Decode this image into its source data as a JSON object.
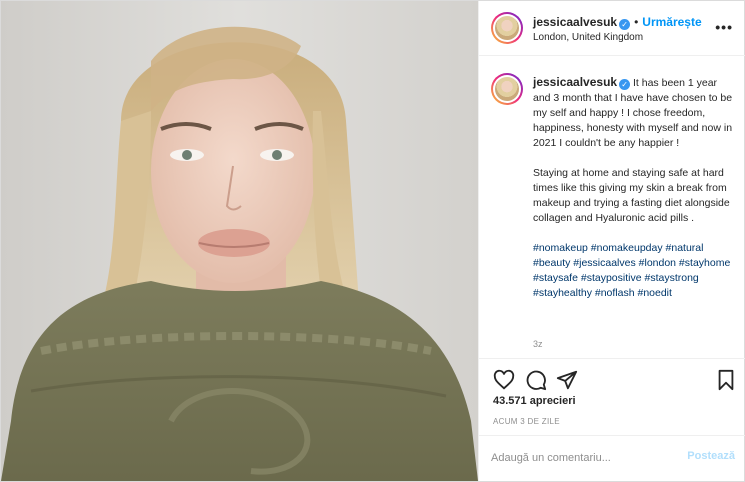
{
  "post": {
    "username": "jessicaalvesuk",
    "verified_icon": "verified-badge-icon",
    "follow_label": "Urmărește",
    "separator": "•",
    "location": "London, United Kingdom",
    "more_label": "•••"
  },
  "caption": {
    "username": "jessicaalvesuk",
    "paragraph1": "It has been 1 year and 3 month that I have have chosen to be my self and happy ! I chose freedom, happiness, honesty with myself and now in 2021 I couldn't be any happier !",
    "paragraph2": "Staying at home and staying safe at hard times like this giving my skin a break from makeup and trying a fasting diet alongside collagen and Hyaluronic acid pills .",
    "hashtags": "#nomakeup #nomakeupday #natural #beauty #jessicaalves #london #stayhome #staysafe #staypositive #staystrong #stayhealthy #noflash #noedit",
    "age": "3z"
  },
  "actions": {
    "like_icon": "heart-icon",
    "comment_icon": "comment-icon",
    "share_icon": "share-icon",
    "save_icon": "bookmark-icon"
  },
  "likes": "43.571 aprecieri",
  "timeago": "ACUM 3 DE ZILE",
  "comment": {
    "placeholder": "Adaugă un comentariu...",
    "post_label": "Postează"
  },
  "colors": {
    "accent": "#0095f6",
    "hashtag": "#00376b",
    "muted": "#8e8e8e",
    "post_disabled": "#b2dffc",
    "border": "#efefef"
  }
}
